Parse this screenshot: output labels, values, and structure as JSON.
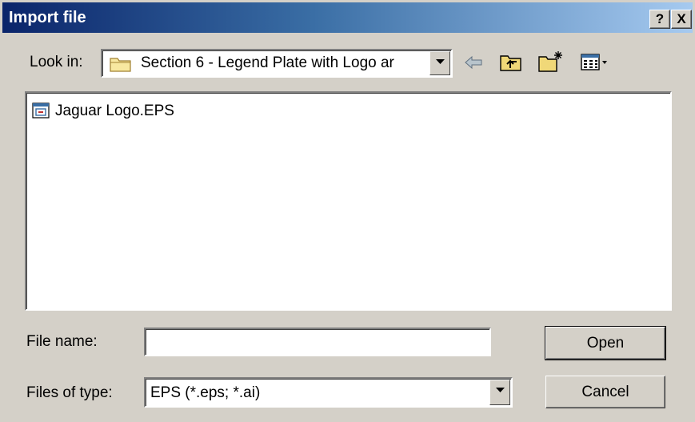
{
  "window": {
    "title": "Import file",
    "help_label": "?",
    "close_label": "X"
  },
  "look_in": {
    "label": "Look in:",
    "value": "Section 6 - Legend Plate with Logo ar"
  },
  "toolbar": {
    "icons": [
      "back-icon",
      "up-folder-icon",
      "new-folder-icon",
      "view-menu-icon"
    ]
  },
  "files": [
    {
      "name": "Jaguar Logo.EPS",
      "icon": "eps-file-icon"
    }
  ],
  "file_name": {
    "label": "File name:",
    "value": ""
  },
  "file_type": {
    "label": "Files of type:",
    "value": "EPS (*.eps; *.ai)"
  },
  "buttons": {
    "open": "Open",
    "cancel": "Cancel"
  },
  "colors": {
    "title_start": "#0a246a",
    "title_end": "#a6caf0",
    "face": "#d4d0c8"
  }
}
